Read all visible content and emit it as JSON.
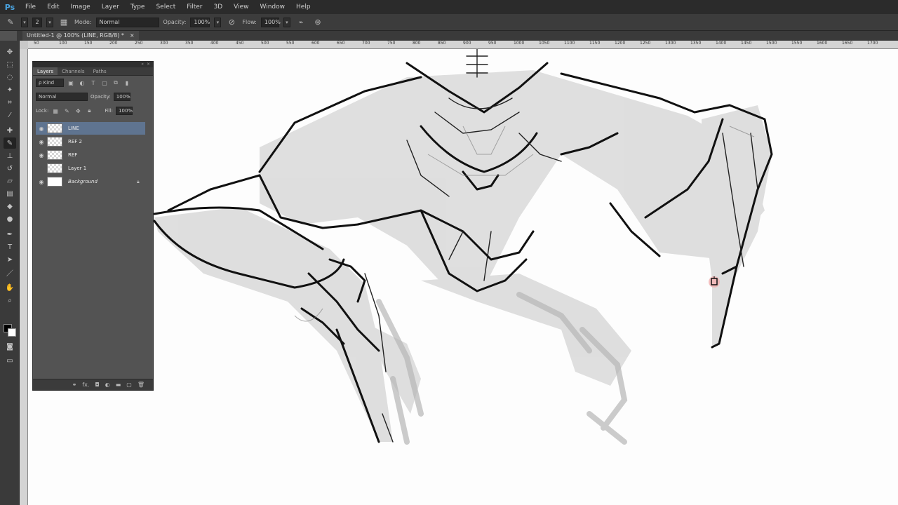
{
  "app": {
    "logo": "Ps"
  },
  "menu": [
    "File",
    "Edit",
    "Image",
    "Layer",
    "Type",
    "Select",
    "Filter",
    "3D",
    "View",
    "Window",
    "Help"
  ],
  "options": {
    "brush_size": "2",
    "mode_label": "Mode:",
    "mode_value": "Normal",
    "opacity_label": "Opacity:",
    "opacity_value": "100%",
    "flow_label": "Flow:",
    "flow_value": "100%"
  },
  "document_tab": {
    "title": "Untitled-1 @ 100% (LINE, RGB/8) *",
    "close": "×"
  },
  "ruler": {
    "ticks": [
      "50",
      "100",
      "150",
      "200",
      "250",
      "300",
      "350",
      "400",
      "450",
      "500",
      "550",
      "600",
      "650",
      "700",
      "750",
      "800",
      "850",
      "900",
      "950",
      "1000",
      "1050",
      "1100",
      "1150",
      "1200",
      "1250",
      "1300",
      "1350",
      "1400",
      "1450",
      "1500",
      "1550",
      "1600",
      "1650",
      "1700"
    ]
  },
  "layers_panel": {
    "tabs": [
      "Layers",
      "Channels",
      "Paths"
    ],
    "kind_label": "ρ Kind",
    "blend_mode": "Normal",
    "opacity_label": "Opacity:",
    "opacity_value": "100%",
    "lock_label": "Lock:",
    "fill_label": "Fill:",
    "fill_value": "100%",
    "layers": [
      {
        "name": "LINE",
        "visible": true,
        "selected": true
      },
      {
        "name": "REF 2",
        "visible": true,
        "selected": false
      },
      {
        "name": "REF",
        "visible": true,
        "selected": false
      },
      {
        "name": "Layer 1",
        "visible": false,
        "selected": false
      },
      {
        "name": "Background",
        "visible": true,
        "selected": false,
        "locked": true
      }
    ],
    "footer_icons": [
      "link-icon",
      "fx-icon",
      "mask-icon",
      "adjustment-icon",
      "folder-icon",
      "new-layer-icon",
      "trash-icon"
    ],
    "footer_glyphs": {
      "fx": "fx."
    }
  },
  "colors": {
    "foreground": "#000000",
    "background": "#ffffff",
    "selected_layer": "#5f7490",
    "accent": "#4aa3df"
  }
}
